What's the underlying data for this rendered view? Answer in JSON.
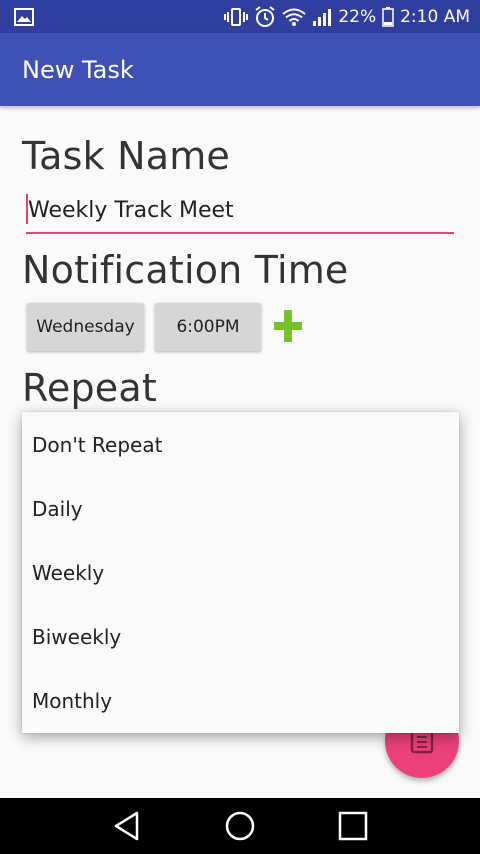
{
  "status_bar": {
    "battery": "22%",
    "time": "2:10 AM",
    "icons": [
      "image-icon",
      "vibrate-icon",
      "alarm-icon",
      "wifi-icon",
      "signal-icon",
      "battery-icon"
    ]
  },
  "app_bar": {
    "title": "New Task"
  },
  "form": {
    "task_name_label": "Task Name",
    "task_name_value": "Weekly Track Meet",
    "notification_label": "Notification Time",
    "day_button": "Wednesday",
    "time_button": "6:00PM",
    "repeat_label": "Repeat"
  },
  "repeat_options": [
    "Don't Repeat",
    "Daily",
    "Weekly",
    "Biweekly",
    "Monthly"
  ],
  "colors": {
    "primary": "#3f51b5",
    "primary_dark": "#303f9f",
    "accent": "#ec407a",
    "add_icon": "#76c22b"
  },
  "nav_bar": {
    "icons": [
      "back-icon",
      "home-icon",
      "recents-icon"
    ]
  }
}
